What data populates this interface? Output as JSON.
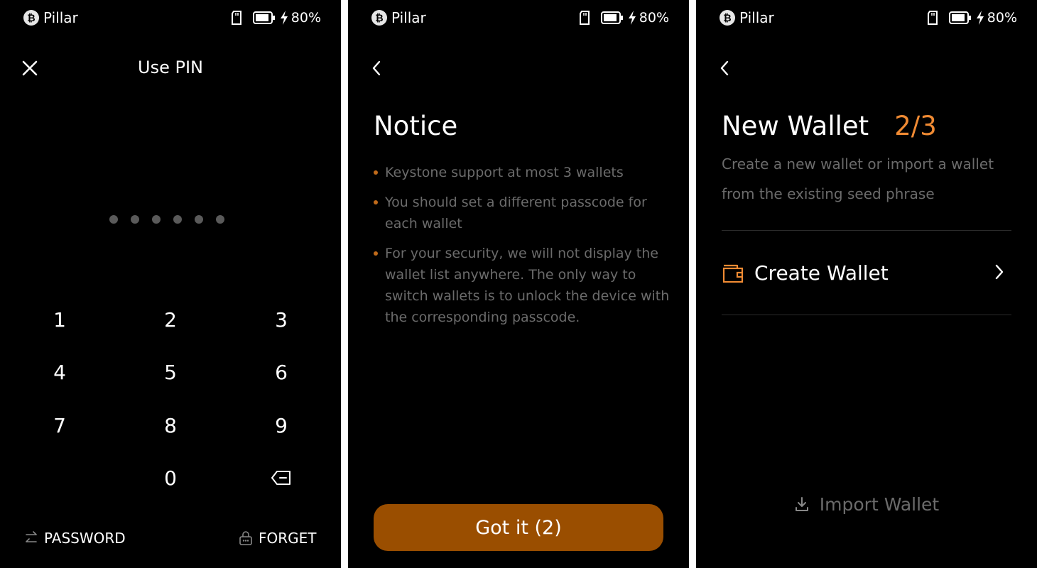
{
  "status_bar": {
    "coin_symbol": "₿",
    "brand": "Pillar",
    "battery_percent": "80%",
    "icons": [
      "sd-card-icon",
      "battery-icon",
      "charging-bolt-icon"
    ]
  },
  "pin_screen": {
    "title": "Use PIN",
    "pin_dots_count": 6,
    "keypad": [
      "1",
      "2",
      "3",
      "4",
      "5",
      "6",
      "7",
      "8",
      "9",
      "0"
    ],
    "password_label": "PASSWORD",
    "forget_label": "FORGET"
  },
  "notice_screen": {
    "title": "Notice",
    "items": [
      "Keystone support at most 3 wallets",
      "You should set a different passcode for each wallet",
      "For your security, we will not display the wallet list anywhere. The only way to switch wallets is to unlock the device with the corresponding passcode."
    ],
    "button_label": "Got it (2)"
  },
  "wallet_screen": {
    "title": "New Wallet",
    "step": "2/3",
    "description": "Create a new wallet or import a wallet from the existing seed phrase",
    "create_label": "Create Wallet",
    "import_label": "Import Wallet"
  },
  "colors": {
    "background": "#000000",
    "accent": "#ef8a33",
    "button": "#9a4e00",
    "muted_text": "#6b6b6b",
    "pin_dot": "#5a5a5a"
  }
}
